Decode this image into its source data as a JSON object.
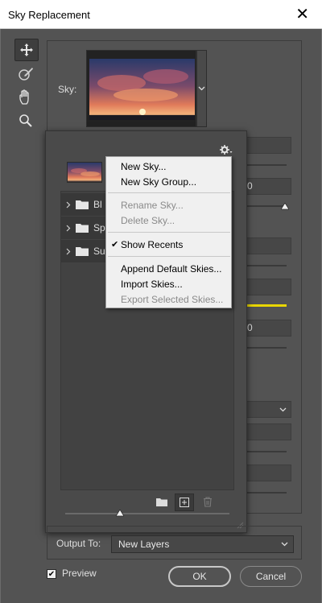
{
  "window": {
    "title": "Sky Replacement",
    "close_glyph": "✕"
  },
  "toolbar": {
    "tools": [
      "move-icon",
      "sky-brush-icon",
      "hand-icon",
      "zoom-icon"
    ]
  },
  "sky": {
    "label": "Sky:"
  },
  "right_fields": {
    "field_2_value": "0",
    "field_5_value": "0"
  },
  "popup": {
    "menu": {
      "new_sky": "New Sky...",
      "new_sky_group": "New Sky Group...",
      "rename_sky": "Rename Sky...",
      "delete_sky": "Delete Sky...",
      "show_recents": "Show Recents",
      "append_default": "Append Default Skies...",
      "import_skies": "Import Skies...",
      "export_selected": "Export Selected Skies..."
    },
    "folders": [
      {
        "label": "Bl"
      },
      {
        "label": "Sp"
      },
      {
        "label": "Su"
      }
    ]
  },
  "output": {
    "label": "Output To:",
    "value": "New Layers"
  },
  "preview": {
    "label": "Preview",
    "checked": true
  },
  "buttons": {
    "ok": "OK",
    "cancel": "Cancel"
  }
}
